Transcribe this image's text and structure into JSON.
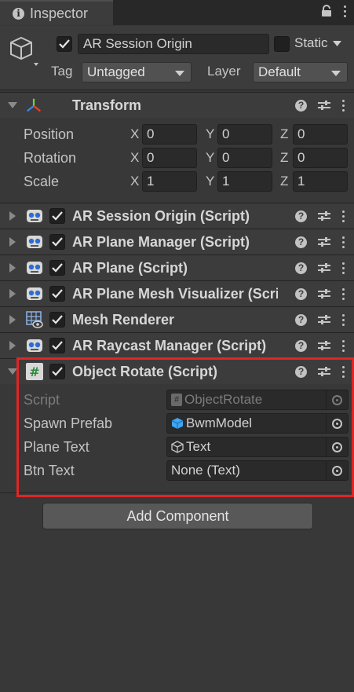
{
  "tab": {
    "title": "Inspector"
  },
  "header": {
    "object_name": "AR Session Origin",
    "static_label": "Static",
    "tag_label": "Tag",
    "tag_value": "Untagged",
    "layer_label": "Layer",
    "layer_value": "Default"
  },
  "transform": {
    "title": "Transform",
    "rows": [
      {
        "label": "Position",
        "x": "0",
        "y": "0",
        "z": "0"
      },
      {
        "label": "Rotation",
        "x": "0",
        "y": "0",
        "z": "0"
      },
      {
        "label": "Scale",
        "x": "1",
        "y": "1",
        "z": "1"
      }
    ],
    "axis": {
      "x": "X",
      "y": "Y",
      "z": "Z"
    }
  },
  "components": [
    {
      "title": "AR Session Origin (Script)",
      "icon": "script-robot-icon"
    },
    {
      "title": "AR Plane Manager (Script)",
      "icon": "script-robot-icon"
    },
    {
      "title": "AR Plane (Script)",
      "icon": "script-robot-icon"
    },
    {
      "title": "AR Plane Mesh Visualizer (Script)",
      "icon": "script-robot-icon"
    },
    {
      "title": "Mesh Renderer",
      "icon": "mesh-renderer-icon"
    },
    {
      "title": "AR Raycast Manager (Script)",
      "icon": "script-robot-icon"
    }
  ],
  "object_rotate": {
    "title": "Object Rotate (Script)",
    "fields": [
      {
        "label": "Script",
        "value": "ObjectRotate",
        "icon": "cs-script-icon",
        "disabled": true
      },
      {
        "label": "Spawn Prefab",
        "value": "BwmModel",
        "icon": "prefab-cube-icon"
      },
      {
        "label": "Plane Text",
        "value": "Text",
        "icon": "gameobject-cube-icon"
      },
      {
        "label": "Btn Text",
        "value": "None (Text)",
        "icon": ""
      }
    ]
  },
  "add_component_label": "Add Component",
  "colors": {
    "highlight": "#e02525",
    "prefab": "#3da7f5"
  }
}
